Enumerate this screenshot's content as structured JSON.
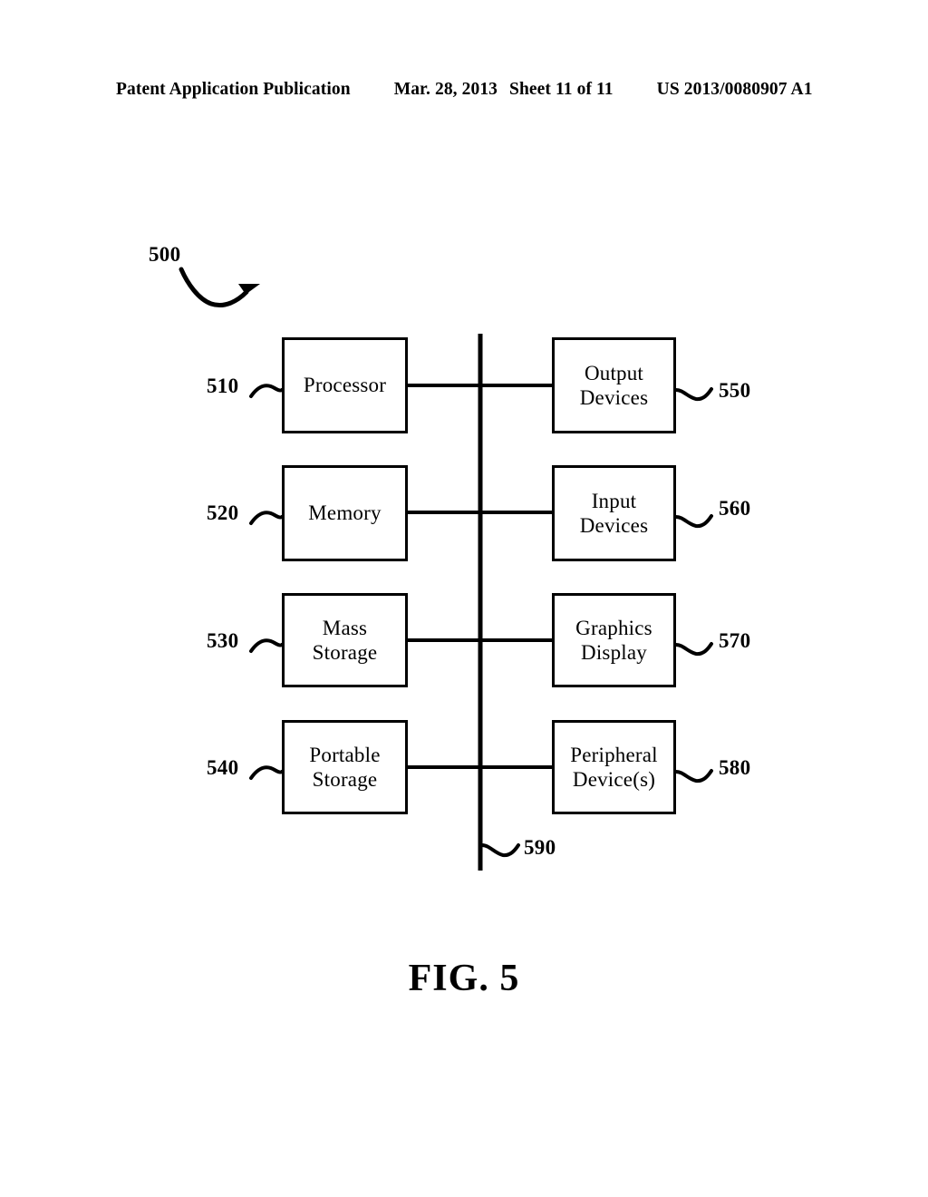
{
  "header": {
    "publication": "Patent Application Publication",
    "date": "Mar. 28, 2013",
    "sheet": "Sheet 11 of 11",
    "number": "US 2013/0080907 A1"
  },
  "figure": {
    "caption": "FIG. 5",
    "system_ref": "500",
    "bus_ref": "590",
    "left_column": [
      {
        "ref": "510",
        "label": "Processor"
      },
      {
        "ref": "520",
        "label": "Memory"
      },
      {
        "ref": "530",
        "label": "Mass\nStorage"
      },
      {
        "ref": "540",
        "label": "Portable\nStorage"
      }
    ],
    "right_column": [
      {
        "ref": "550",
        "label": "Output\nDevices"
      },
      {
        "ref": "560",
        "label": "Input\nDevices"
      },
      {
        "ref": "570",
        "label": "Graphics\nDisplay"
      },
      {
        "ref": "580",
        "label": "Peripheral\nDevice(s)"
      }
    ]
  },
  "colors": {
    "ink": "#000000",
    "paper": "#ffffff"
  }
}
